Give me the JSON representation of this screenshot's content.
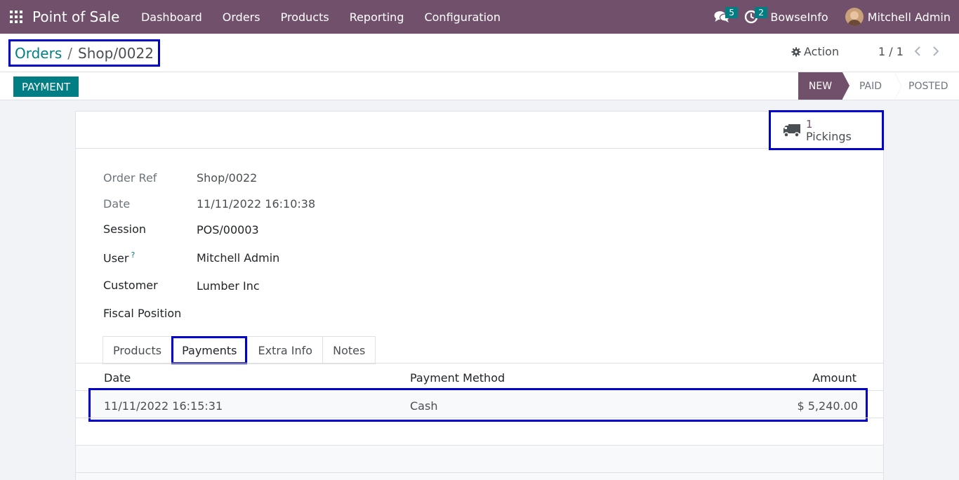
{
  "navbar": {
    "app_name": "Point of Sale",
    "menu": [
      "Dashboard",
      "Orders",
      "Products",
      "Reporting",
      "Configuration"
    ],
    "messages_count": "5",
    "activities_count": "2",
    "company": "BowseInfo",
    "user": "Mitchell Admin",
    "color": "#71506b"
  },
  "breadcrumb": {
    "parent": "Orders",
    "separator": "/",
    "current": "Shop/0022"
  },
  "control": {
    "action_label": "Action",
    "pager": "1 / 1"
  },
  "statusbar": {
    "payment_label": "PAYMENT",
    "steps": [
      "NEW",
      "PAID",
      "POSTED"
    ],
    "active_step": "NEW"
  },
  "smart_button": {
    "count": "1",
    "label": "Pickings",
    "icon": "truck-icon"
  },
  "fields": {
    "order_ref": {
      "label": "Order Ref",
      "value": "Shop/0022"
    },
    "date": {
      "label": "Date",
      "value": "11/11/2022 16:10:38"
    },
    "session": {
      "label": "Session",
      "value": "POS/00003"
    },
    "user": {
      "label": "User",
      "help": "?",
      "value": "Mitchell Admin"
    },
    "customer": {
      "label": "Customer",
      "value": "Lumber Inc"
    },
    "fiscal_position": {
      "label": "Fiscal Position",
      "value": ""
    }
  },
  "tabs": [
    "Products",
    "Payments",
    "Extra Info",
    "Notes"
  ],
  "active_tab": "Payments",
  "payments": {
    "columns": [
      "Date",
      "Payment Method",
      "Amount"
    ],
    "rows": [
      {
        "date": "11/11/2022 16:15:31",
        "method": "Cash",
        "amount": "$ 5,240.00"
      }
    ]
  },
  "colors": {
    "accent": "#017e84",
    "annotation": "#0000cc"
  }
}
